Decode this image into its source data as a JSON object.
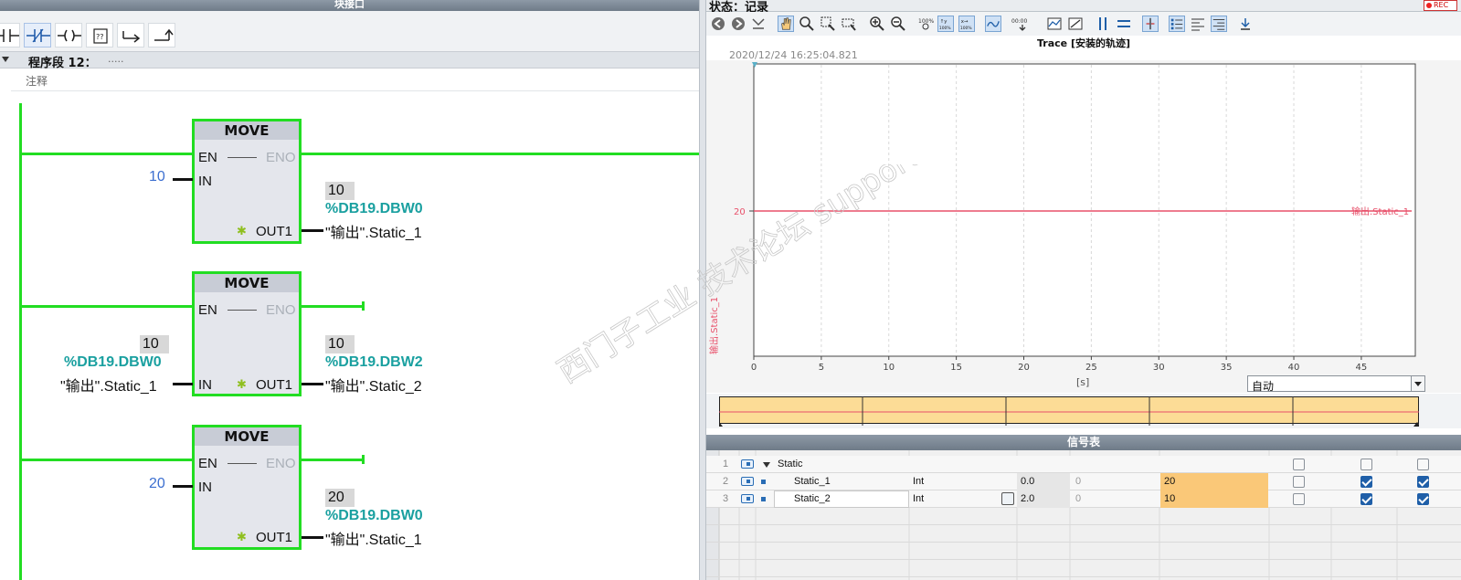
{
  "lad": {
    "window_title": "块接口",
    "network": {
      "title": "程序段 12：",
      "dots": ".....",
      "comment": "注释"
    },
    "blocks": [
      {
        "title": "MOVE",
        "en": "EN",
        "eno": "ENO",
        "in": "IN",
        "out": "OUT1",
        "in_value": "10",
        "out_value": "10",
        "out_addr": "%DB19.DBW0",
        "out_name": "\"输出\".Static_1"
      },
      {
        "title": "MOVE",
        "en": "EN",
        "eno": "ENO",
        "in": "IN",
        "out": "OUT1",
        "in_value": "10",
        "in_addr": "%DB19.DBW0",
        "in_name": "\"输出\".Static_1",
        "out_value": "10",
        "out_addr": "%DB19.DBW2",
        "out_name": "\"输出\".Static_2"
      },
      {
        "title": "MOVE",
        "en": "EN",
        "eno": "ENO",
        "in": "IN",
        "out": "OUT1",
        "in_value": "20",
        "out_value": "20",
        "out_addr": "%DB19.DBW0",
        "out_name": "\"输出\".Static_1"
      }
    ]
  },
  "trace": {
    "window_title": "状态：记录",
    "rec_badge": "REC",
    "chart_title": "Trace [安装的轨迹]",
    "timestamp": "2020/12/24 16:25:04.821",
    "xunit": "[s]",
    "y_signal_label": "输出.Static_1",
    "y_tick": "20",
    "line_label": "输出.Static_1",
    "x_ticks": [
      "0",
      "5",
      "10",
      "15",
      "20",
      "25",
      "30",
      "35",
      "40",
      "45"
    ],
    "auto_select": "自动",
    "signal_table": {
      "title": "信号表",
      "rows": [
        {
          "num": "1",
          "name": "Static",
          "type": "",
          "value": "",
          "min": "",
          "modify": ""
        },
        {
          "num": "2",
          "name": "Static_1",
          "type": "Int",
          "value": "0.0",
          "min": "0",
          "modify": "20"
        },
        {
          "num": "3",
          "name": "Static_2",
          "type": "Int",
          "value": "2.0",
          "min": "0",
          "modify": "10"
        }
      ]
    }
  },
  "watermark": "西门子工业 技术论坛 support.industry.siemens.com/cs",
  "colors": {
    "wire": "#22dd22",
    "trace_line": "#e8506a",
    "modify_bg": "#fac878",
    "address": "#1aa0a0",
    "input_const": "#3c6fd0"
  }
}
